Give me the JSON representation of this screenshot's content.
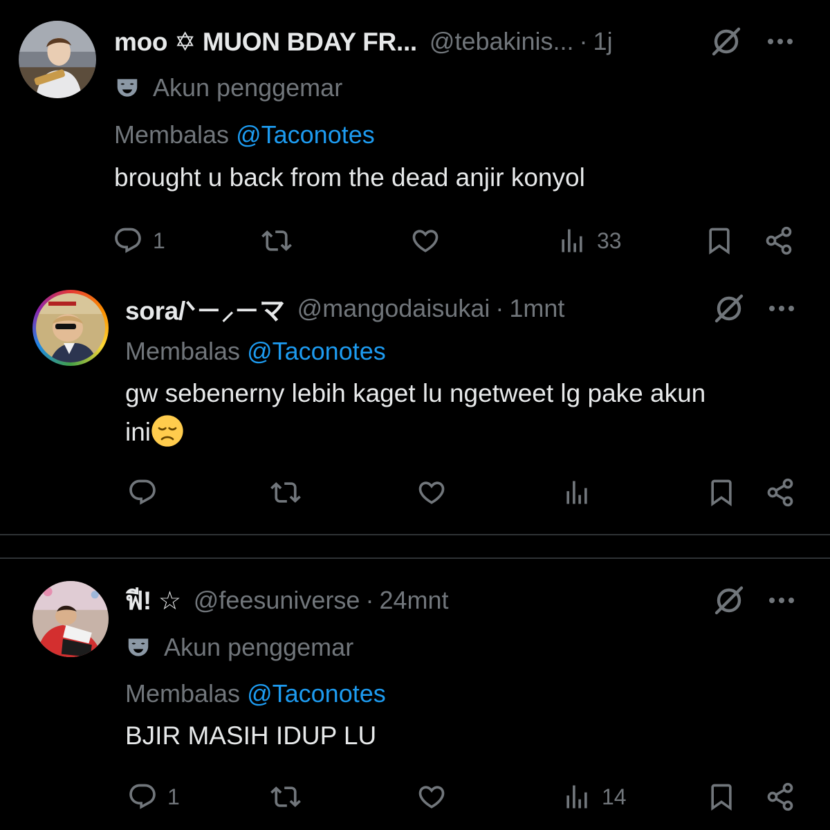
{
  "tweets": [
    {
      "name": "moo ✡ MUON BDAY FR...",
      "handle": "@tebakinis...",
      "separator": "·",
      "time": "1j",
      "badge_label": "Akun penggemar",
      "reply_prefix": "Membalas",
      "reply_to": "@Taconotes",
      "text": "brought u back from the dead anjir konyol",
      "actions": {
        "replies": "1",
        "retweets": "",
        "likes": "",
        "views": "33"
      }
    },
    {
      "name": "sora/ᐠ－⸝－マ",
      "handle": "@mangodaisukai",
      "separator": "·",
      "time": "1mnt",
      "reply_prefix": "Membalas",
      "reply_to": "@Taconotes",
      "text_line1": "gw sebenerny lebih kaget lu ngetweet lg pake akun",
      "text_line2": "ini",
      "actions": {
        "replies": "",
        "retweets": "",
        "likes": "",
        "views": ""
      }
    },
    {
      "name": "ฟี! ☆",
      "handle": "@feesuniverse",
      "separator": "·",
      "time": "24mnt",
      "badge_label": "Akun penggemar",
      "reply_prefix": "Membalas",
      "reply_to": "@Taconotes",
      "text": "BJIR MASIH IDUP LU",
      "actions": {
        "replies": "1",
        "retweets": "",
        "likes": "",
        "views": "14"
      }
    }
  ],
  "icons": {
    "reply": "reply-icon",
    "retweet": "retweet-icon",
    "like": "heart-icon",
    "views": "views-icon",
    "bookmark": "bookmark-icon",
    "share": "share-icon",
    "grok": "grok-icon",
    "more": "more-icon",
    "badge": "mask-icon"
  },
  "colors": {
    "background": "#000000",
    "text": "#e7e9ea",
    "muted": "#71767b",
    "link": "#1d9bf0",
    "divider": "#2f3336"
  }
}
